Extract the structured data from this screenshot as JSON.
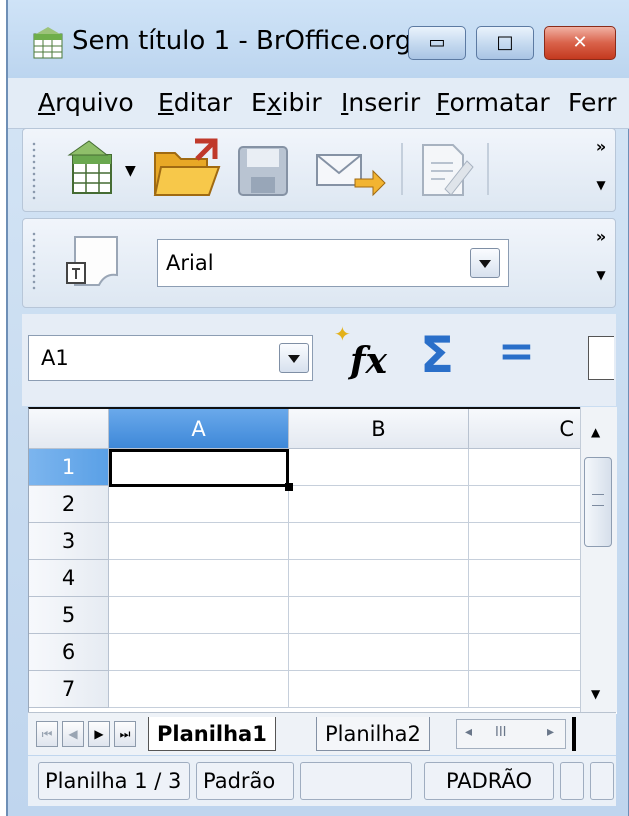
{
  "window": {
    "title": "Sem título 1 - BrOffice.org ...",
    "minimize_glyph": "▭",
    "maximize_glyph": "□",
    "close_glyph": "✕"
  },
  "menu": [
    "Arquivo",
    "Editar",
    "Exibir",
    "Inserir",
    "Formatar",
    "Ferr"
  ],
  "menu_mnemonics": [
    "A",
    "E",
    "x",
    "I",
    "F",
    ""
  ],
  "toolbar_standard": {
    "icons": [
      "new-spreadsheet-icon",
      "dropdown-arrow-icon",
      "open-folder-icon",
      "save-icon",
      "email-icon",
      "edit-file-icon"
    ],
    "overflow": "»"
  },
  "toolbar_formatting": {
    "style_icon": "styles-icon",
    "font_name": "Arial",
    "overflow": "»"
  },
  "formula_bar": {
    "name_box": "A1",
    "function_wizard": "fx",
    "sum": "Σ",
    "equals": "="
  },
  "grid": {
    "columns": [
      "A",
      "B",
      "C"
    ],
    "rows": [
      "1",
      "2",
      "3",
      "4",
      "5",
      "6",
      "7"
    ],
    "active_cell": "A1"
  },
  "tabs": {
    "nav": [
      "⏮",
      "◀",
      "▶",
      "⏭"
    ],
    "sheets": [
      "Planilha1",
      "Planilha2"
    ],
    "active": "Planilha1",
    "hscroll_left": "◂",
    "hscroll_thumb": "III",
    "hscroll_right": "▸"
  },
  "status": {
    "sheet": "Planilha 1 / 3",
    "style": "Padrão",
    "field3": "",
    "mode": "PADRÃO"
  },
  "colors": {
    "selected_header": "#3e88d8",
    "selected_row_header": "#5aa0e6",
    "close_button": "#c4391f"
  }
}
